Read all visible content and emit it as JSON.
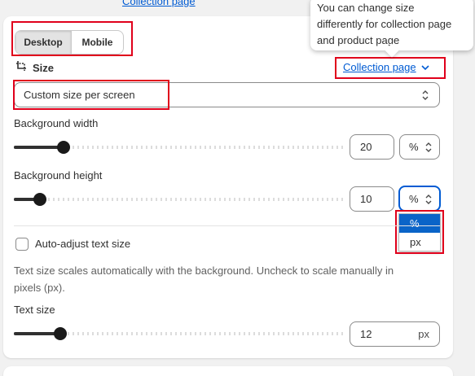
{
  "tooltip": {
    "lines": [
      "You can change size",
      "differently for collection page",
      "and product page"
    ]
  },
  "top_link": {
    "label": "Collection page"
  },
  "device_toggle": {
    "desktop": "Desktop",
    "mobile": "Mobile",
    "selected": "Desktop"
  },
  "size": {
    "label": "Size",
    "page_selector": "Collection page",
    "mode_select": "Custom size per screen"
  },
  "background_width": {
    "label": "Background width",
    "value": "20",
    "unit": "%",
    "slider_fraction": 0.15
  },
  "background_height": {
    "label": "Background height",
    "value": "10",
    "unit": "%",
    "slider_fraction": 0.08
  },
  "unit_options": [
    "%",
    "px"
  ],
  "unit_options_selected": "%",
  "auto_adjust": {
    "label": "Auto-adjust text size",
    "checked": false,
    "help_line1": "Text size scales automatically with the background. Uncheck to scale manually in",
    "help_line2": "pixels (px)."
  },
  "text_size": {
    "label": "Text size",
    "value": "12",
    "unit": "px",
    "slider_fraction": 0.14
  },
  "colors": {
    "accent": "#005bd3",
    "annotation": "#e0001b",
    "selected_option": "#0a64c8"
  }
}
